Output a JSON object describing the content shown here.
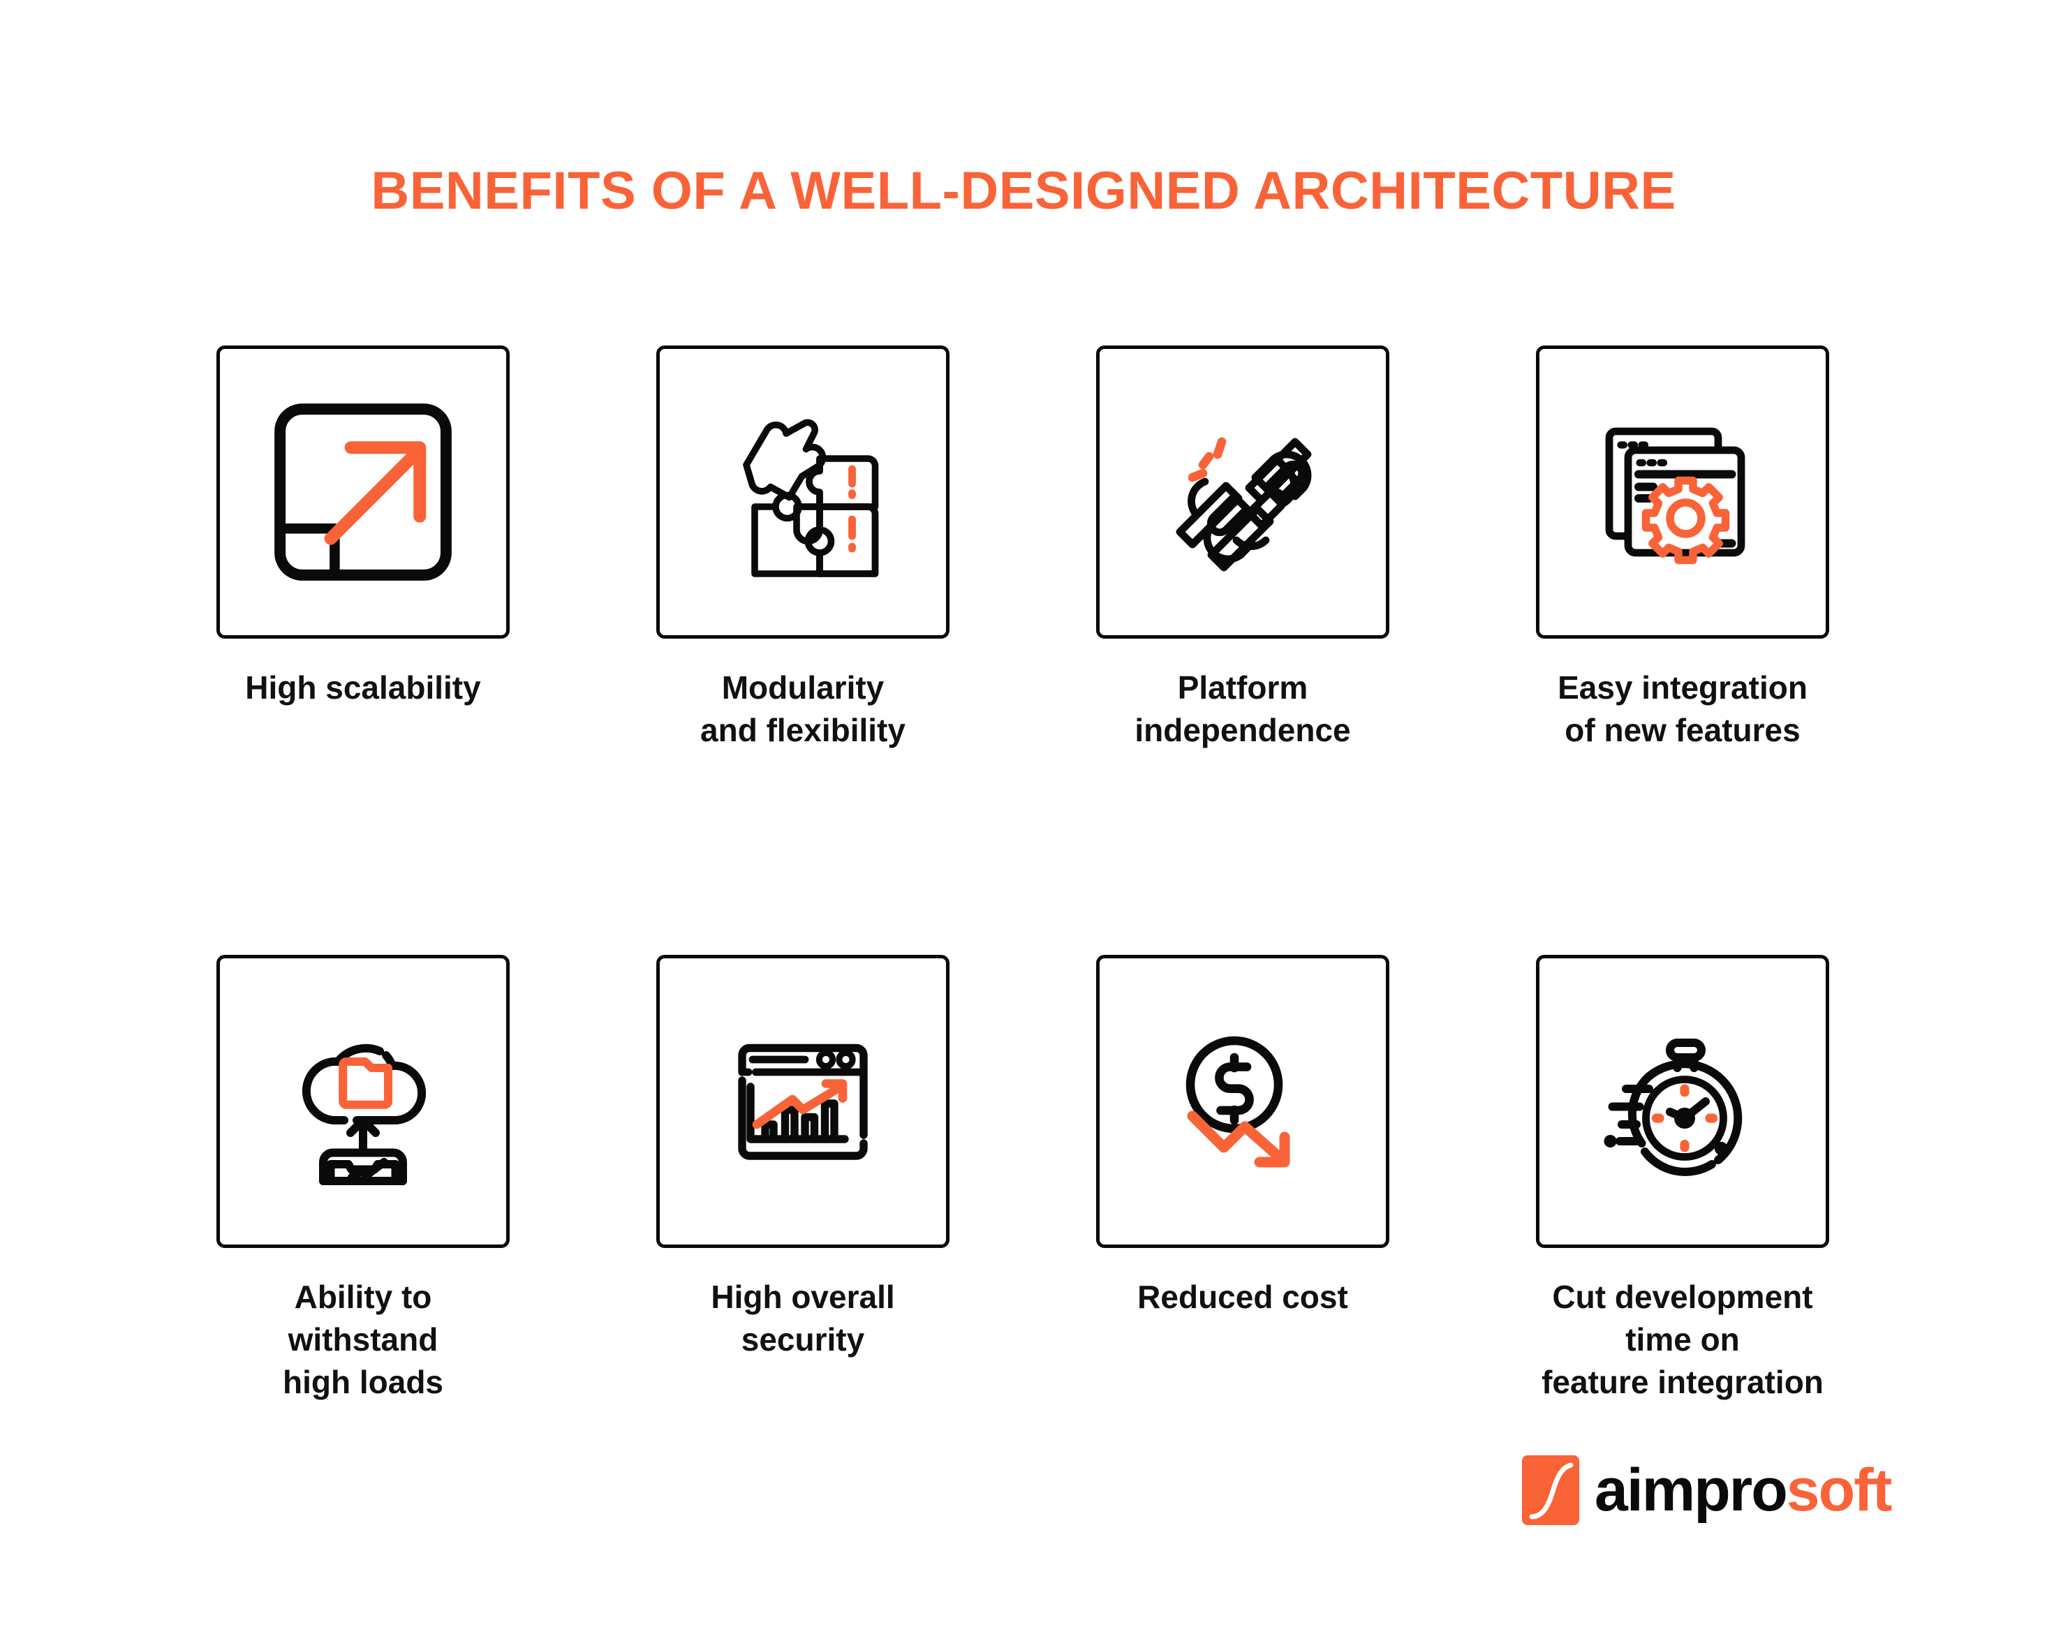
{
  "title": "BENEFITS OF A WELL-DESIGNED ARCHITECTURE",
  "colors": {
    "accent": "#F96337",
    "ink": "#0a0a0a",
    "background": "#ffffff"
  },
  "benefits": [
    {
      "label": "High scalability",
      "icon": "scalability-arrow-icon"
    },
    {
      "label": "Modularity\nand flexibility",
      "icon": "puzzle-pieces-icon"
    },
    {
      "label": "Platform\nindependence",
      "icon": "broken-chain-link-icon"
    },
    {
      "label": "Easy integration\nof new features",
      "icon": "browser-windows-gear-icon"
    },
    {
      "label": "Ability to withstand\nhigh loads",
      "icon": "cloud-upload-server-icon"
    },
    {
      "label": "High overall\nsecurity",
      "icon": "browser-bar-chart-icon"
    },
    {
      "label": "Reduced cost",
      "icon": "dollar-coin-down-arrow-icon"
    },
    {
      "label": "Cut development time on\nfeature integration",
      "icon": "fast-stopwatch-icon"
    }
  ],
  "logo": {
    "mark": "aimprosoft-s-curve-mark",
    "text_dark": "aimpro",
    "text_accent": "soft"
  }
}
